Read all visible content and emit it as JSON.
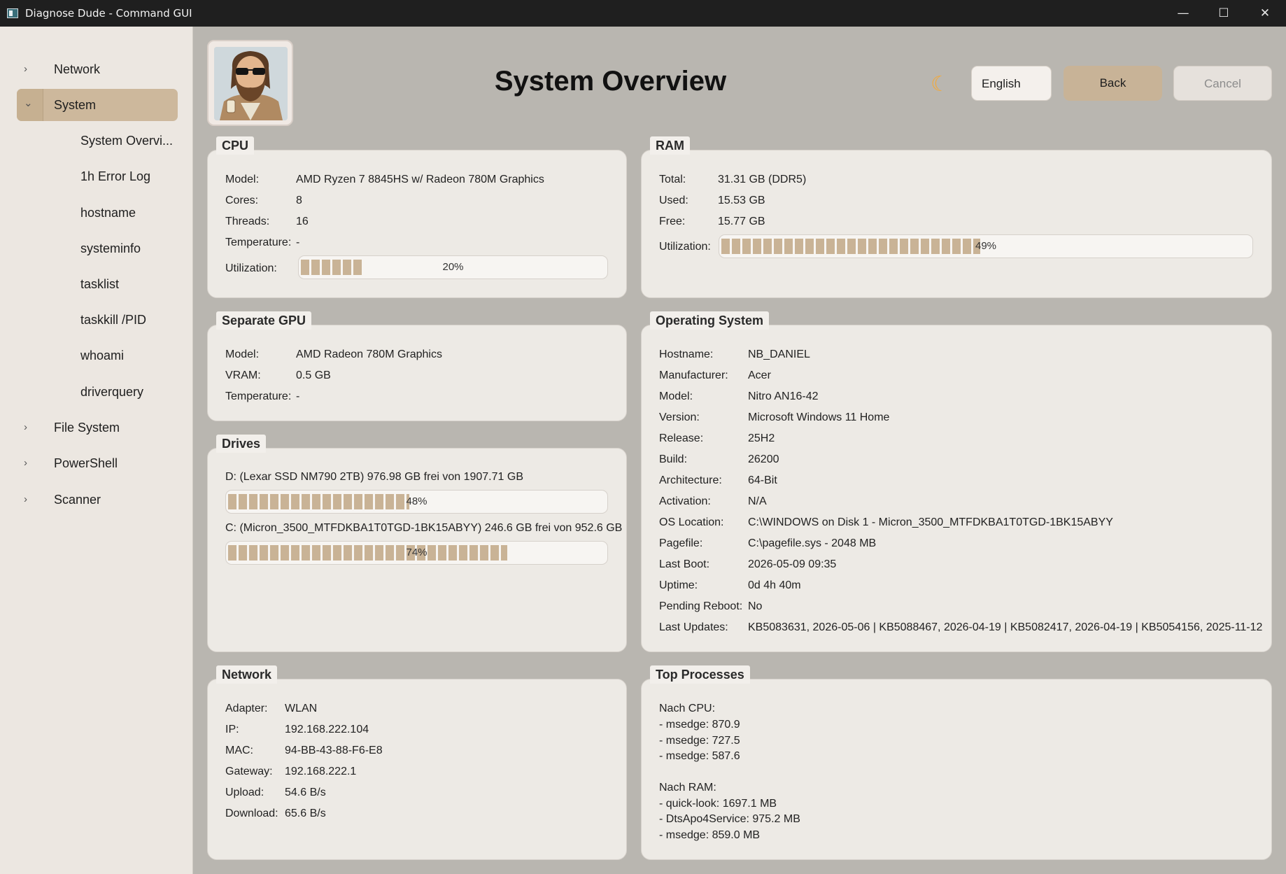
{
  "window": {
    "title": "Diagnose Dude - Command GUI",
    "min": "—",
    "max": "☐",
    "close": "✕"
  },
  "sidebar": {
    "items": [
      {
        "label": "Network",
        "chev": "›"
      },
      {
        "label": "System",
        "chev": "⌄"
      },
      {
        "label": "File System",
        "chev": "›"
      },
      {
        "label": "PowerShell",
        "chev": "›"
      },
      {
        "label": "Scanner",
        "chev": "›"
      }
    ],
    "subitems": [
      "System Overvi...",
      "1h Error Log",
      "hostname",
      "systeminfo",
      "tasklist",
      "taskkill /PID",
      "whoami",
      "driverquery"
    ]
  },
  "header": {
    "title": "System Overview",
    "theme_icon": "☾",
    "language": "English",
    "back": "Back",
    "cancel": "Cancel"
  },
  "cpu": {
    "title": "CPU",
    "rows": [
      {
        "k": "Model:",
        "v": "AMD Ryzen 7 8845HS w/ Radeon 780M Graphics"
      },
      {
        "k": "Cores:",
        "v": "8"
      },
      {
        "k": "Threads:",
        "v": "16"
      },
      {
        "k": "Temperature:",
        "v": "-"
      }
    ],
    "util_label": "Utilization:",
    "util_text": "20%",
    "util_value": 0.2
  },
  "ram": {
    "title": "RAM",
    "rows": [
      {
        "k": "Total:",
        "v": "31.31 GB (DDR5)"
      },
      {
        "k": "Used:",
        "v": "15.53 GB"
      },
      {
        "k": "Free:",
        "v": "15.77 GB"
      }
    ],
    "util_label": "Utilization:",
    "util_text": "49%",
    "util_value": 0.49
  },
  "gpu": {
    "title": "Separate GPU",
    "rows": [
      {
        "k": "Model:",
        "v": "AMD Radeon 780M Graphics"
      },
      {
        "k": "VRAM:",
        "v": "0.5 GB"
      },
      {
        "k": "Temperature:",
        "v": "-"
      }
    ]
  },
  "os": {
    "title": "Operating System",
    "rows": [
      {
        "k": "Hostname:",
        "v": "NB_DANIEL"
      },
      {
        "k": "Manufacturer:",
        "v": "Acer"
      },
      {
        "k": "Model:",
        "v": "Nitro AN16-42"
      },
      {
        "k": "Version:",
        "v": "Microsoft Windows 11 Home"
      },
      {
        "k": "Release:",
        "v": "25H2"
      },
      {
        "k": "Build:",
        "v": "26200"
      },
      {
        "k": "Architecture:",
        "v": "64-Bit"
      },
      {
        "k": "Activation:",
        "v": "N/A"
      },
      {
        "k": "OS Location:",
        "v": "C:\\WINDOWS on Disk 1 - Micron_3500_MTFDKBA1T0TGD-1BK15ABYY"
      },
      {
        "k": "Pagefile:",
        "v": "C:\\pagefile.sys - 2048 MB"
      },
      {
        "k": "Last Boot:",
        "v": "2026-05-09 09:35"
      },
      {
        "k": "Uptime:",
        "v": "0d 4h 40m"
      },
      {
        "k": "Pending Reboot:",
        "v": "No"
      },
      {
        "k": "Last Updates:",
        "v": "KB5083631, 2026-05-06 | KB5088467, 2026-04-19 | KB5082417, 2026-04-19 | KB5054156, 2025-11-12"
      }
    ]
  },
  "drives": {
    "title": "Drives",
    "items": [
      {
        "label": "D: (Lexar SSD NM790 2TB) 976.98 GB frei von 1907.71 GB",
        "text": "48%",
        "value": 0.48
      },
      {
        "label": "C: (Micron_3500_MTFDKBA1T0TGD-1BK15ABYY) 246.6 GB frei von 952.6 GB",
        "text": "74%",
        "value": 0.74
      }
    ]
  },
  "network": {
    "title": "Network",
    "rows": [
      {
        "k": "Adapter:",
        "v": "WLAN"
      },
      {
        "k": "IP:",
        "v": "192.168.222.104"
      },
      {
        "k": "MAC:",
        "v": "94-BB-43-88-F6-E8"
      },
      {
        "k": "Gateway:",
        "v": "192.168.222.1"
      },
      {
        "k": "Upload:",
        "v": "54.6 B/s"
      },
      {
        "k": "Download:",
        "v": "65.6 B/s"
      }
    ]
  },
  "processes": {
    "title": "Top Processes",
    "lines": [
      "Nach CPU:",
      " - msedge: 870.9",
      " - msedge: 727.5",
      " - msedge: 587.6",
      "",
      "Nach RAM:",
      " - quick-look: 1697.1 MB",
      " - DtsApo4Service: 975.2 MB",
      " - msedge: 859.0 MB"
    ]
  },
  "colors": {
    "accent": "#c9b396",
    "sidebar": "#ece7e1",
    "panel": "#edeae5",
    "background": "#b9b6b0",
    "titlebar": "#1f1f1f"
  }
}
